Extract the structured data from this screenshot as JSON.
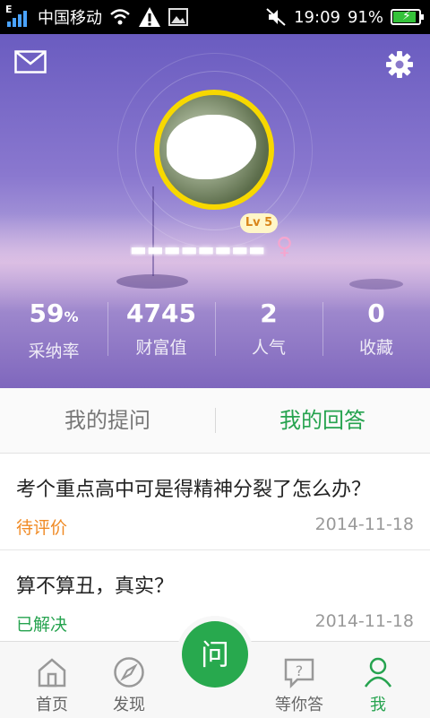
{
  "status_bar": {
    "network_type": "E",
    "carrier": "中国移动",
    "time": "19:09",
    "battery": "91%",
    "battery_level": 0.91
  },
  "header": {
    "mail_icon": "mail-icon",
    "settings_icon": "gear-icon"
  },
  "profile": {
    "level": "Lv 5",
    "gender_symbol": "♀",
    "stats": [
      {
        "value": "59",
        "unit": "%",
        "label": "采纳率"
      },
      {
        "value": "4745",
        "unit": "",
        "label": "财富值"
      },
      {
        "value": "2",
        "unit": "",
        "label": "人气"
      },
      {
        "value": "0",
        "unit": "",
        "label": "收藏"
      }
    ]
  },
  "tabs": [
    {
      "label": "我的提问",
      "active": false
    },
    {
      "label": "我的回答",
      "active": true
    }
  ],
  "items": [
    {
      "question": "考个重点高中可是得精神分裂了怎么办？",
      "status": "待评价",
      "status_color": "#f08a24",
      "date": "2014-11-18"
    },
    {
      "question": "算不算丑，真实？",
      "status": "已解决",
      "status_color": "#26a34f",
      "date": "2014-11-18"
    }
  ],
  "bottom_nav": {
    "items": [
      {
        "label": "首页",
        "icon": "home-icon"
      },
      {
        "label": "发现",
        "icon": "compass-icon"
      },
      {
        "label": "等你答",
        "icon": "chat-question-icon"
      },
      {
        "label": "我",
        "icon": "user-icon",
        "active": true
      }
    ],
    "ask_button": "问"
  },
  "colors": {
    "accent": "#26a34f",
    "pending": "#f08a24",
    "level_badge": "#f7d800"
  }
}
